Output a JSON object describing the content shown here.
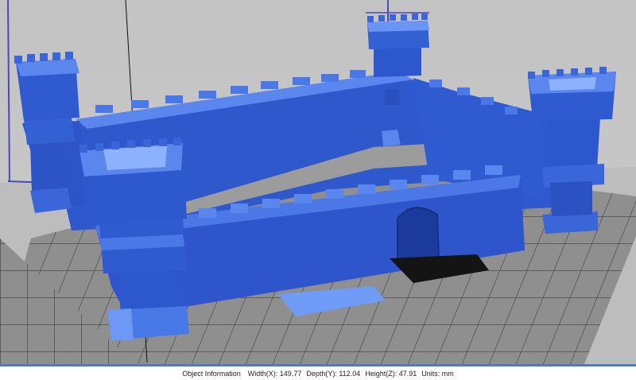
{
  "app": {
    "viewport_icon": "3d-model-view",
    "model_color": "#3a66d9",
    "bed_color": "#9a9a9a",
    "background_color": "#c6c6c6"
  },
  "status": {
    "title": "Object Information",
    "width": "Width(X): 149.77",
    "depth": "Depth(Y): 112.04",
    "height": "Height(Z): 47.91",
    "units": "Units: mm"
  }
}
